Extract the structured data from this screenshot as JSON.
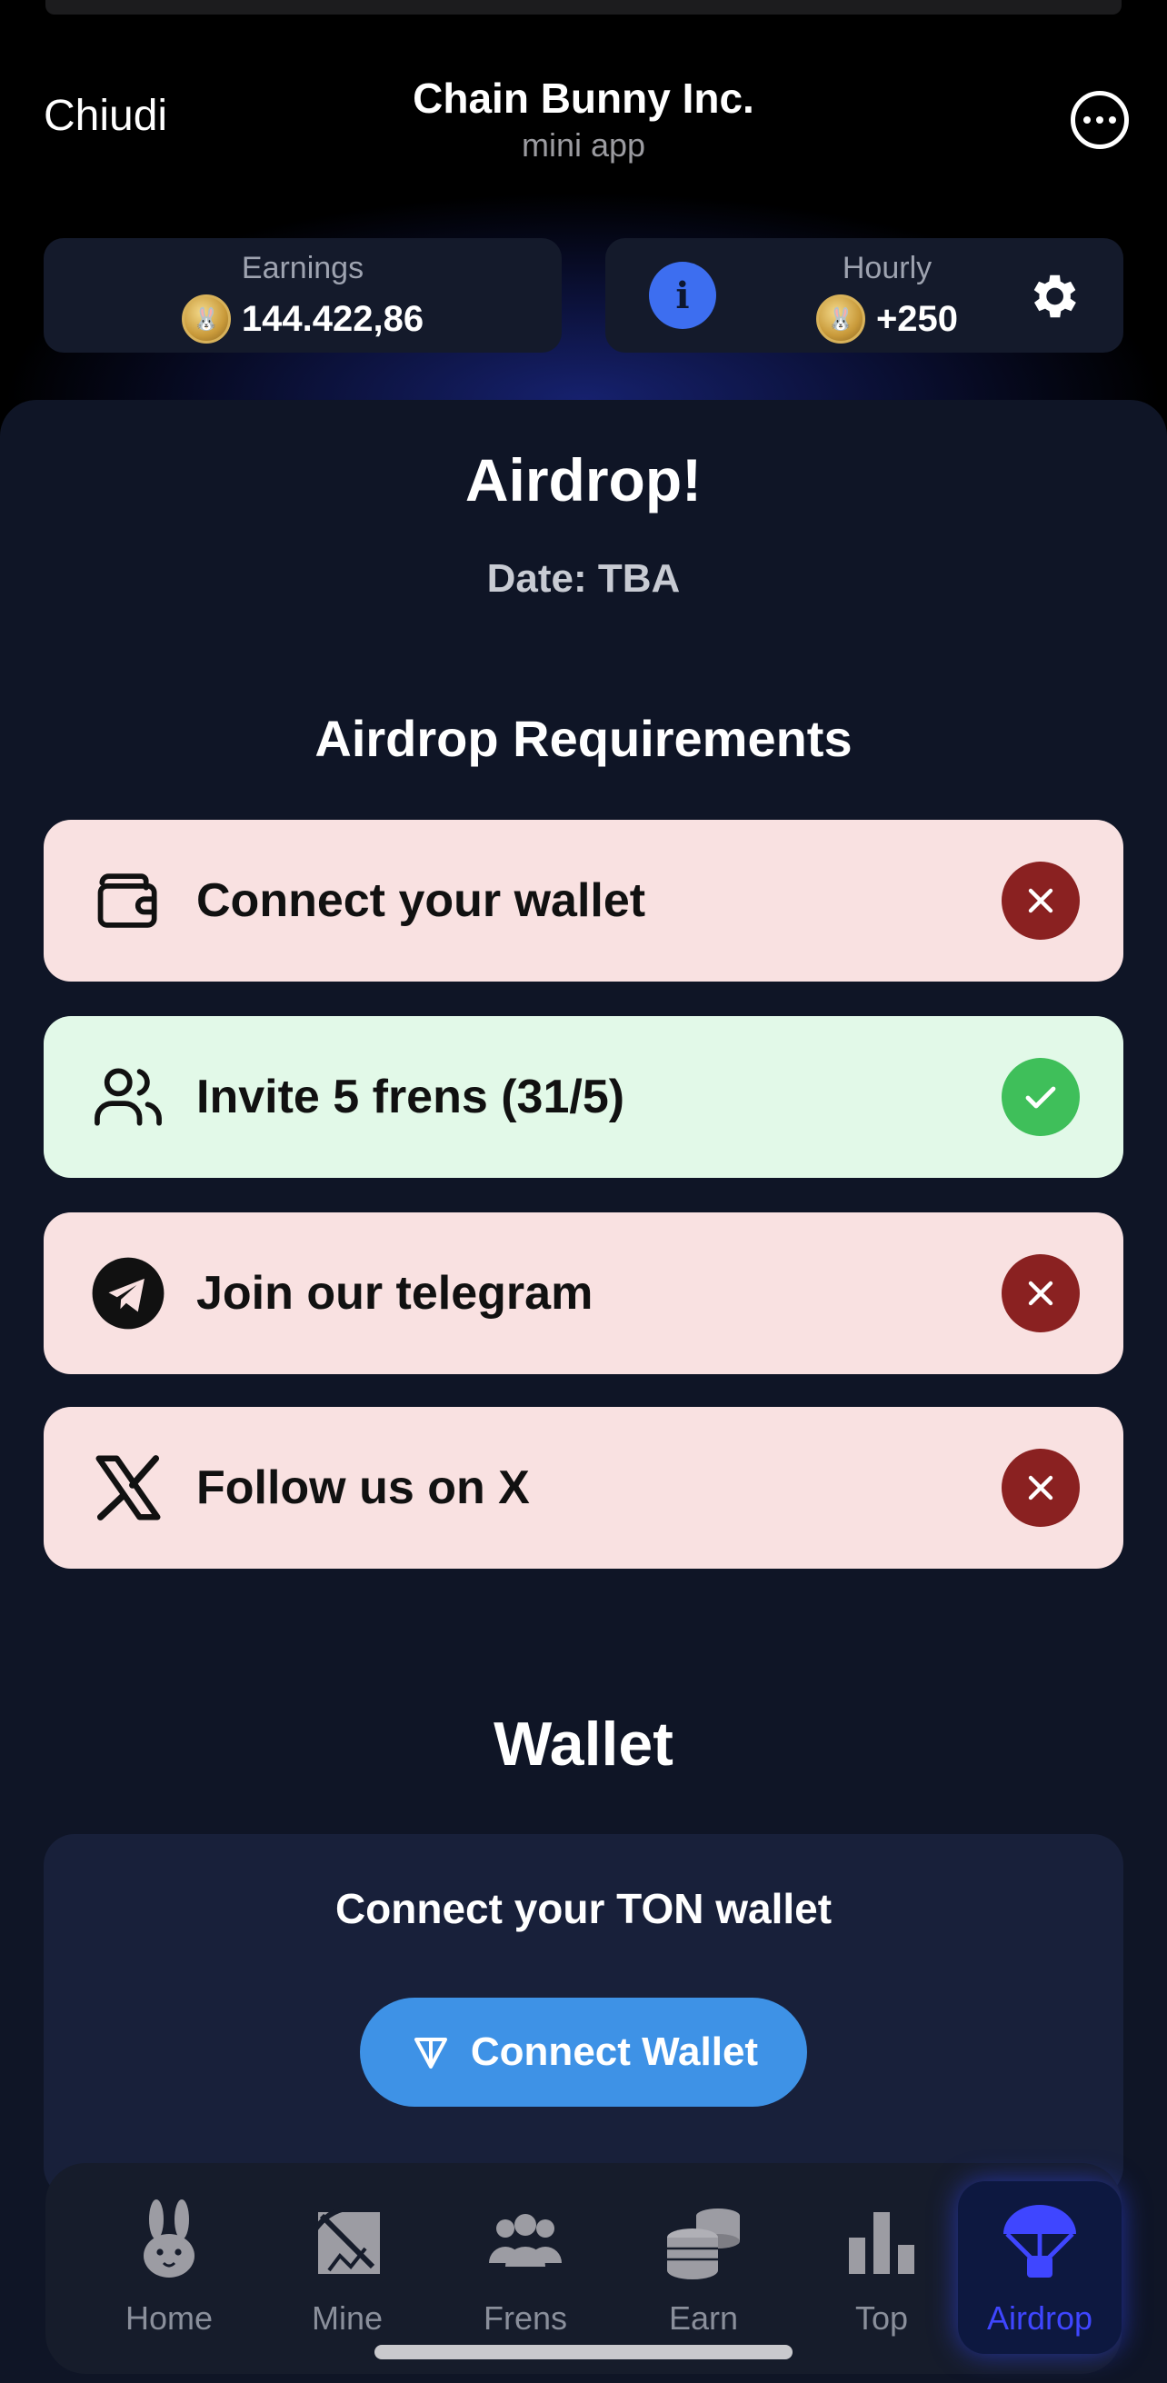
{
  "header": {
    "close_label": "Chiudi",
    "title": "Chain Bunny Inc.",
    "subtitle": "mini app",
    "more_icon": "more-horizontal-icon"
  },
  "stats": {
    "earnings": {
      "label": "Earnings",
      "value": "144.422,86"
    },
    "hourly": {
      "label": "Hourly",
      "value": "+250"
    },
    "info_icon": "info-icon",
    "settings_icon": "gear-icon"
  },
  "airdrop": {
    "title": "Airdrop!",
    "date": "Date: TBA",
    "requirements_heading": "Airdrop Requirements",
    "requirements": [
      {
        "label": "Connect your wallet",
        "icon": "wallet-icon",
        "done": false
      },
      {
        "label": "Invite 5 frens (31/5)",
        "icon": "users-icon",
        "done": true
      },
      {
        "label": "Join our telegram",
        "icon": "telegram-icon",
        "done": false
      },
      {
        "label": "Follow us on X",
        "icon": "x-logo-icon",
        "done": false
      }
    ]
  },
  "wallet": {
    "title": "Wallet",
    "prompt": "Connect your TON wallet",
    "button_label": "Connect Wallet"
  },
  "nav": {
    "items": [
      {
        "label": "Home",
        "icon": "bunny-icon",
        "active": false
      },
      {
        "label": "Mine",
        "icon": "pickaxe-icon",
        "active": false
      },
      {
        "label": "Frens",
        "icon": "group-icon",
        "active": false
      },
      {
        "label": "Earn",
        "icon": "coins-icon",
        "active": false
      },
      {
        "label": "Top",
        "icon": "bar-chart-icon",
        "active": false
      },
      {
        "label": "Airdrop",
        "icon": "parachute-icon",
        "active": true
      }
    ]
  },
  "colors": {
    "background": "#000000",
    "panel": "#0f1526",
    "fail_row": "#f9e1e1",
    "ok_row": "#e2f9e8",
    "fail_badge": "#8a2121",
    "ok_badge": "#3fbf5a",
    "accent_blue": "#3e92e6",
    "nav_active": "#3f46ff"
  }
}
